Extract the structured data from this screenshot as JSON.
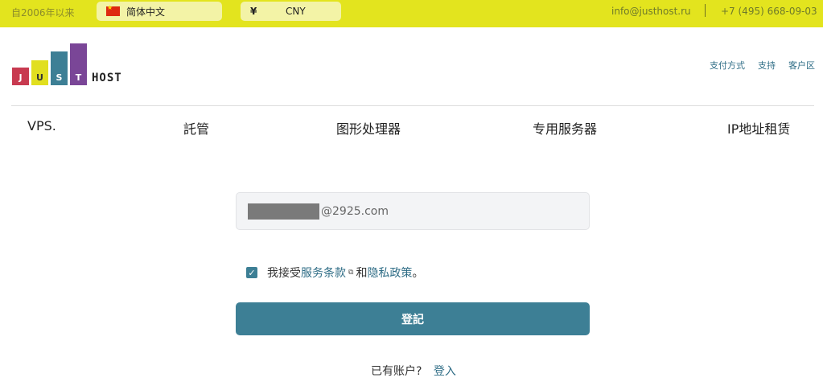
{
  "topbar": {
    "since": "自2006年以来",
    "language": "简体中文",
    "currency_symbol": "¥",
    "currency": "CNY",
    "email": "info@justhost.ru",
    "phone": "+7 (495) 668-09-03"
  },
  "logo": {
    "letters": [
      "J",
      "U",
      "S",
      "T"
    ],
    "host": "HOST"
  },
  "top_links": [
    "支付方式",
    "支持",
    "客户区"
  ],
  "nav": [
    "VPS.",
    "託管",
    "图形处理器",
    "专用服务器",
    "IP地址租赁"
  ],
  "form": {
    "email_value": "@2925.com",
    "agree_prefix": "我接受",
    "terms_link": "服务条款",
    "and": "和",
    "privacy_link": "隐私政策",
    "agree_suffix": "。",
    "submit_label": "登記",
    "have_account": "已有账户?",
    "login_link": "登入"
  },
  "colors": {
    "topbar": "#e3e41e",
    "accent": "#3d7f95",
    "logo_red": "#c83a50",
    "logo_yellow": "#e1df1f",
    "logo_teal": "#3d7f95",
    "logo_purple": "#7a4697"
  }
}
